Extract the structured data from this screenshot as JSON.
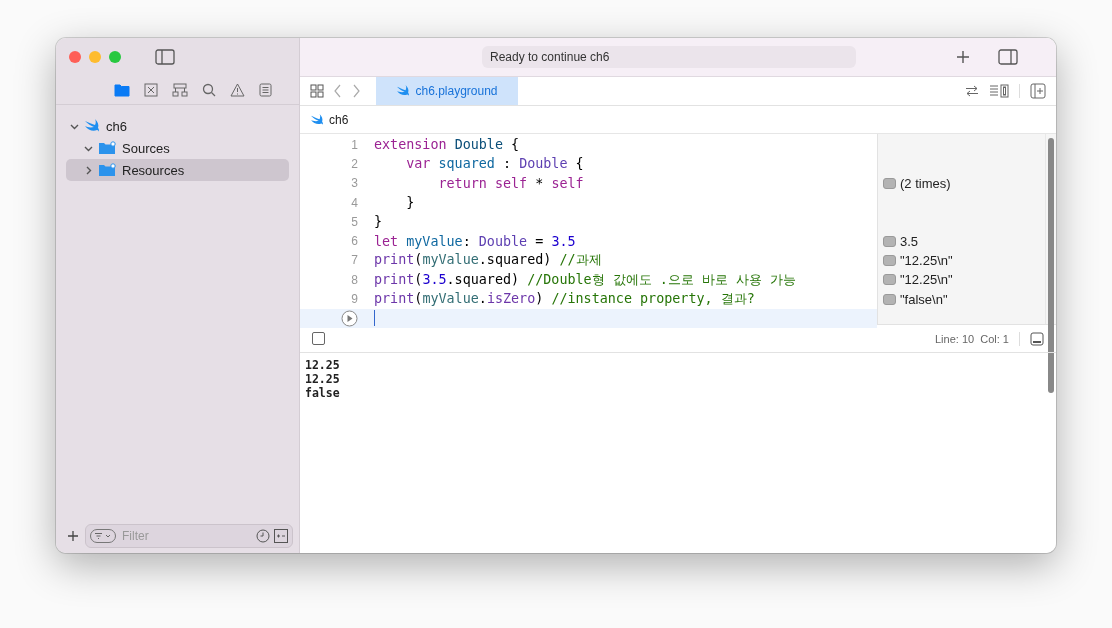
{
  "window": {
    "status": "Ready to continue ch6"
  },
  "navigator": {
    "tools": [
      {
        "kind": "folder",
        "selected": true
      },
      {
        "kind": "xbox",
        "selected": false
      },
      {
        "kind": "hierarchy",
        "selected": false
      },
      {
        "kind": "search",
        "selected": false
      },
      {
        "kind": "warning",
        "selected": false
      },
      {
        "kind": "list",
        "selected": false
      }
    ],
    "tree": [
      {
        "label": "ch6",
        "kind": "swift",
        "expanded": true,
        "selected": false,
        "children": [
          {
            "label": "Sources",
            "kind": "folder",
            "expanded": true,
            "selected": false
          },
          {
            "label": "Resources",
            "kind": "folder",
            "expanded": false,
            "selected": true
          }
        ]
      }
    ],
    "filter": {
      "placeholder": "Filter"
    }
  },
  "editor": {
    "tab": {
      "label": "ch6.playground",
      "selected": true
    },
    "breadcrumb": "ch6",
    "lines": [
      {
        "number": "1",
        "current": false,
        "tokens": [
          {
            "kind": "keyword",
            "text": "extension "
          },
          {
            "kind": "typedecl",
            "text": "Double"
          },
          {
            "kind": "plain",
            "text": " {"
          }
        ]
      },
      {
        "number": "2",
        "current": false,
        "tokens": [
          {
            "kind": "keyword",
            "text": "    var "
          },
          {
            "kind": "decl",
            "text": "squared"
          },
          {
            "kind": "plain",
            "text": " : "
          },
          {
            "kind": "type",
            "text": "Double"
          },
          {
            "kind": "plain",
            "text": " {"
          }
        ]
      },
      {
        "number": "3",
        "current": false,
        "result": "(2 times)",
        "tokens": [
          {
            "kind": "keyword",
            "text": "        return self"
          },
          {
            "kind": "plain",
            "text": " * "
          },
          {
            "kind": "keyword",
            "text": "self"
          }
        ]
      },
      {
        "number": "4",
        "current": false,
        "tokens": [
          {
            "kind": "plain",
            "text": "    }"
          }
        ]
      },
      {
        "number": "5",
        "current": false,
        "tokens": [
          {
            "kind": "plain",
            "text": "}"
          }
        ]
      },
      {
        "number": "6",
        "current": false,
        "result": "3.5",
        "tokens": [
          {
            "kind": "keyword",
            "text": "let "
          },
          {
            "kind": "decl",
            "text": "myValue"
          },
          {
            "kind": "plain",
            "text": ": "
          },
          {
            "kind": "type",
            "text": "Double"
          },
          {
            "kind": "plain",
            "text": " = "
          },
          {
            "kind": "number",
            "text": "3.5"
          }
        ]
      },
      {
        "number": "7",
        "current": false,
        "result": "\"12.25\\n\"",
        "tokens": [
          {
            "kind": "func",
            "text": "print"
          },
          {
            "kind": "plain",
            "text": "("
          },
          {
            "kind": "ref",
            "text": "myValue"
          },
          {
            "kind": "plain",
            "text": ".squared) "
          },
          {
            "kind": "comment",
            "text": "//과제"
          }
        ]
      },
      {
        "number": "8",
        "current": false,
        "result": "\"12.25\\n\"",
        "tokens": [
          {
            "kind": "func",
            "text": "print"
          },
          {
            "kind": "plain",
            "text": "("
          },
          {
            "kind": "number",
            "text": "3.5"
          },
          {
            "kind": "plain",
            "text": ".squared) "
          },
          {
            "kind": "comment",
            "text": "//Double형 값에도 .으로 바로 사용 가능"
          }
        ]
      },
      {
        "number": "9",
        "current": false,
        "result": "\"false\\n\"",
        "tokens": [
          {
            "kind": "func",
            "text": "print"
          },
          {
            "kind": "plain",
            "text": "("
          },
          {
            "kind": "ref",
            "text": "myValue"
          },
          {
            "kind": "plain",
            "text": "."
          },
          {
            "kind": "func",
            "text": "isZero"
          },
          {
            "kind": "plain",
            "text": ") "
          },
          {
            "kind": "comment",
            "text": "//instance property, 결과?"
          }
        ]
      },
      {
        "current": true
      }
    ],
    "position": "Line: 10  Col: 1"
  },
  "console": {
    "toggle": {
      "checked": false
    },
    "output": [
      "12.25",
      "12.25",
      "false"
    ]
  }
}
